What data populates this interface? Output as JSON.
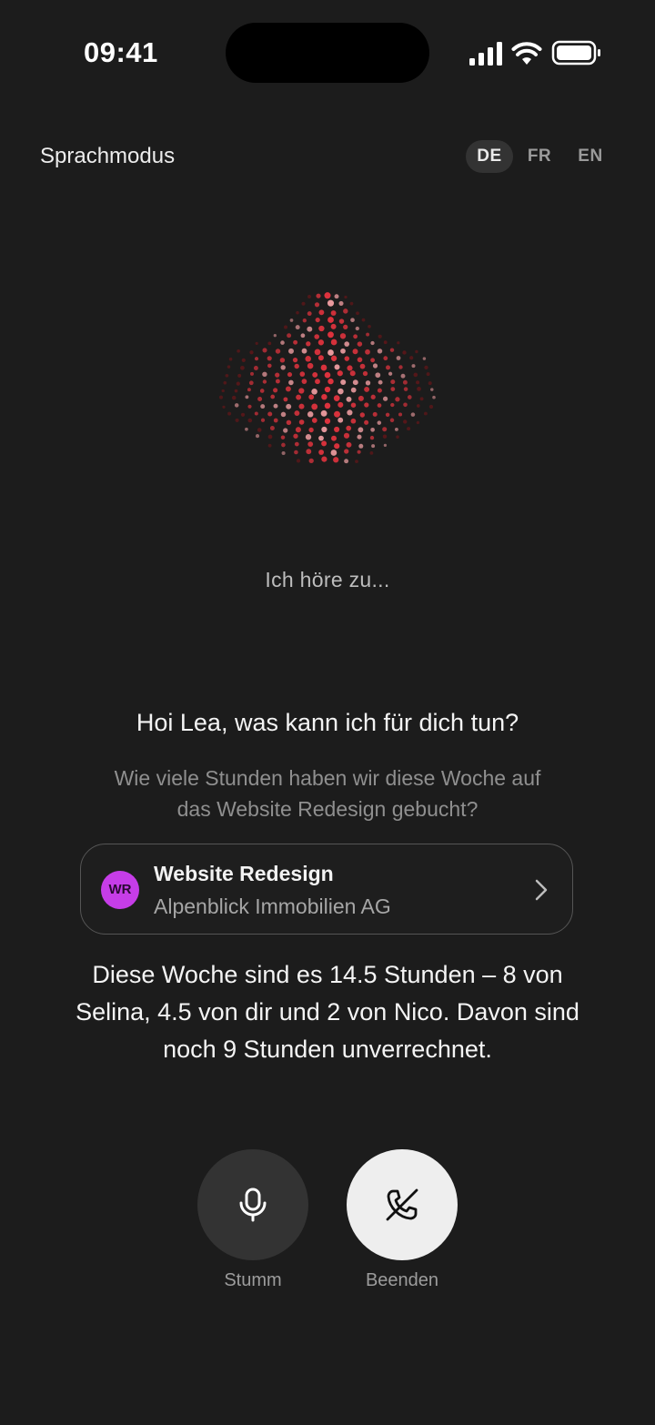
{
  "status_bar": {
    "time": "09:41",
    "icons": [
      "cellular-signal-icon",
      "wifi-icon",
      "battery-icon"
    ]
  },
  "header": {
    "title": "Sprachmodus",
    "languages": [
      {
        "code": "DE",
        "active": true
      },
      {
        "code": "FR",
        "active": false
      },
      {
        "code": "EN",
        "active": false
      }
    ]
  },
  "assistant": {
    "orb_icon": "voice-orb-icon",
    "status": "Ich höre zu...",
    "greeting": "Hoi Lea, was kann ich für dich tun?"
  },
  "conversation": {
    "user_query": "Wie viele Stunden haben wir diese Woche auf das Website Redesign gebucht?",
    "project_card": {
      "avatar_initials": "WR",
      "name": "Website Redesign",
      "client": "Alpenblick Immobilien AG"
    },
    "answer": "Diese Woche sind es 14.5 Stunden – 8 von Selina, 4.5 von dir und 2 von Nico. Davon sind noch 9 Stunden unverrechnet."
  },
  "controls": {
    "mute_label": "Stumm",
    "end_label": "Beenden"
  },
  "colors": {
    "background": "#1c1c1c",
    "orb_accent": "#e8343f",
    "avatar": "#c63de8",
    "end_button": "#eeeeee"
  }
}
